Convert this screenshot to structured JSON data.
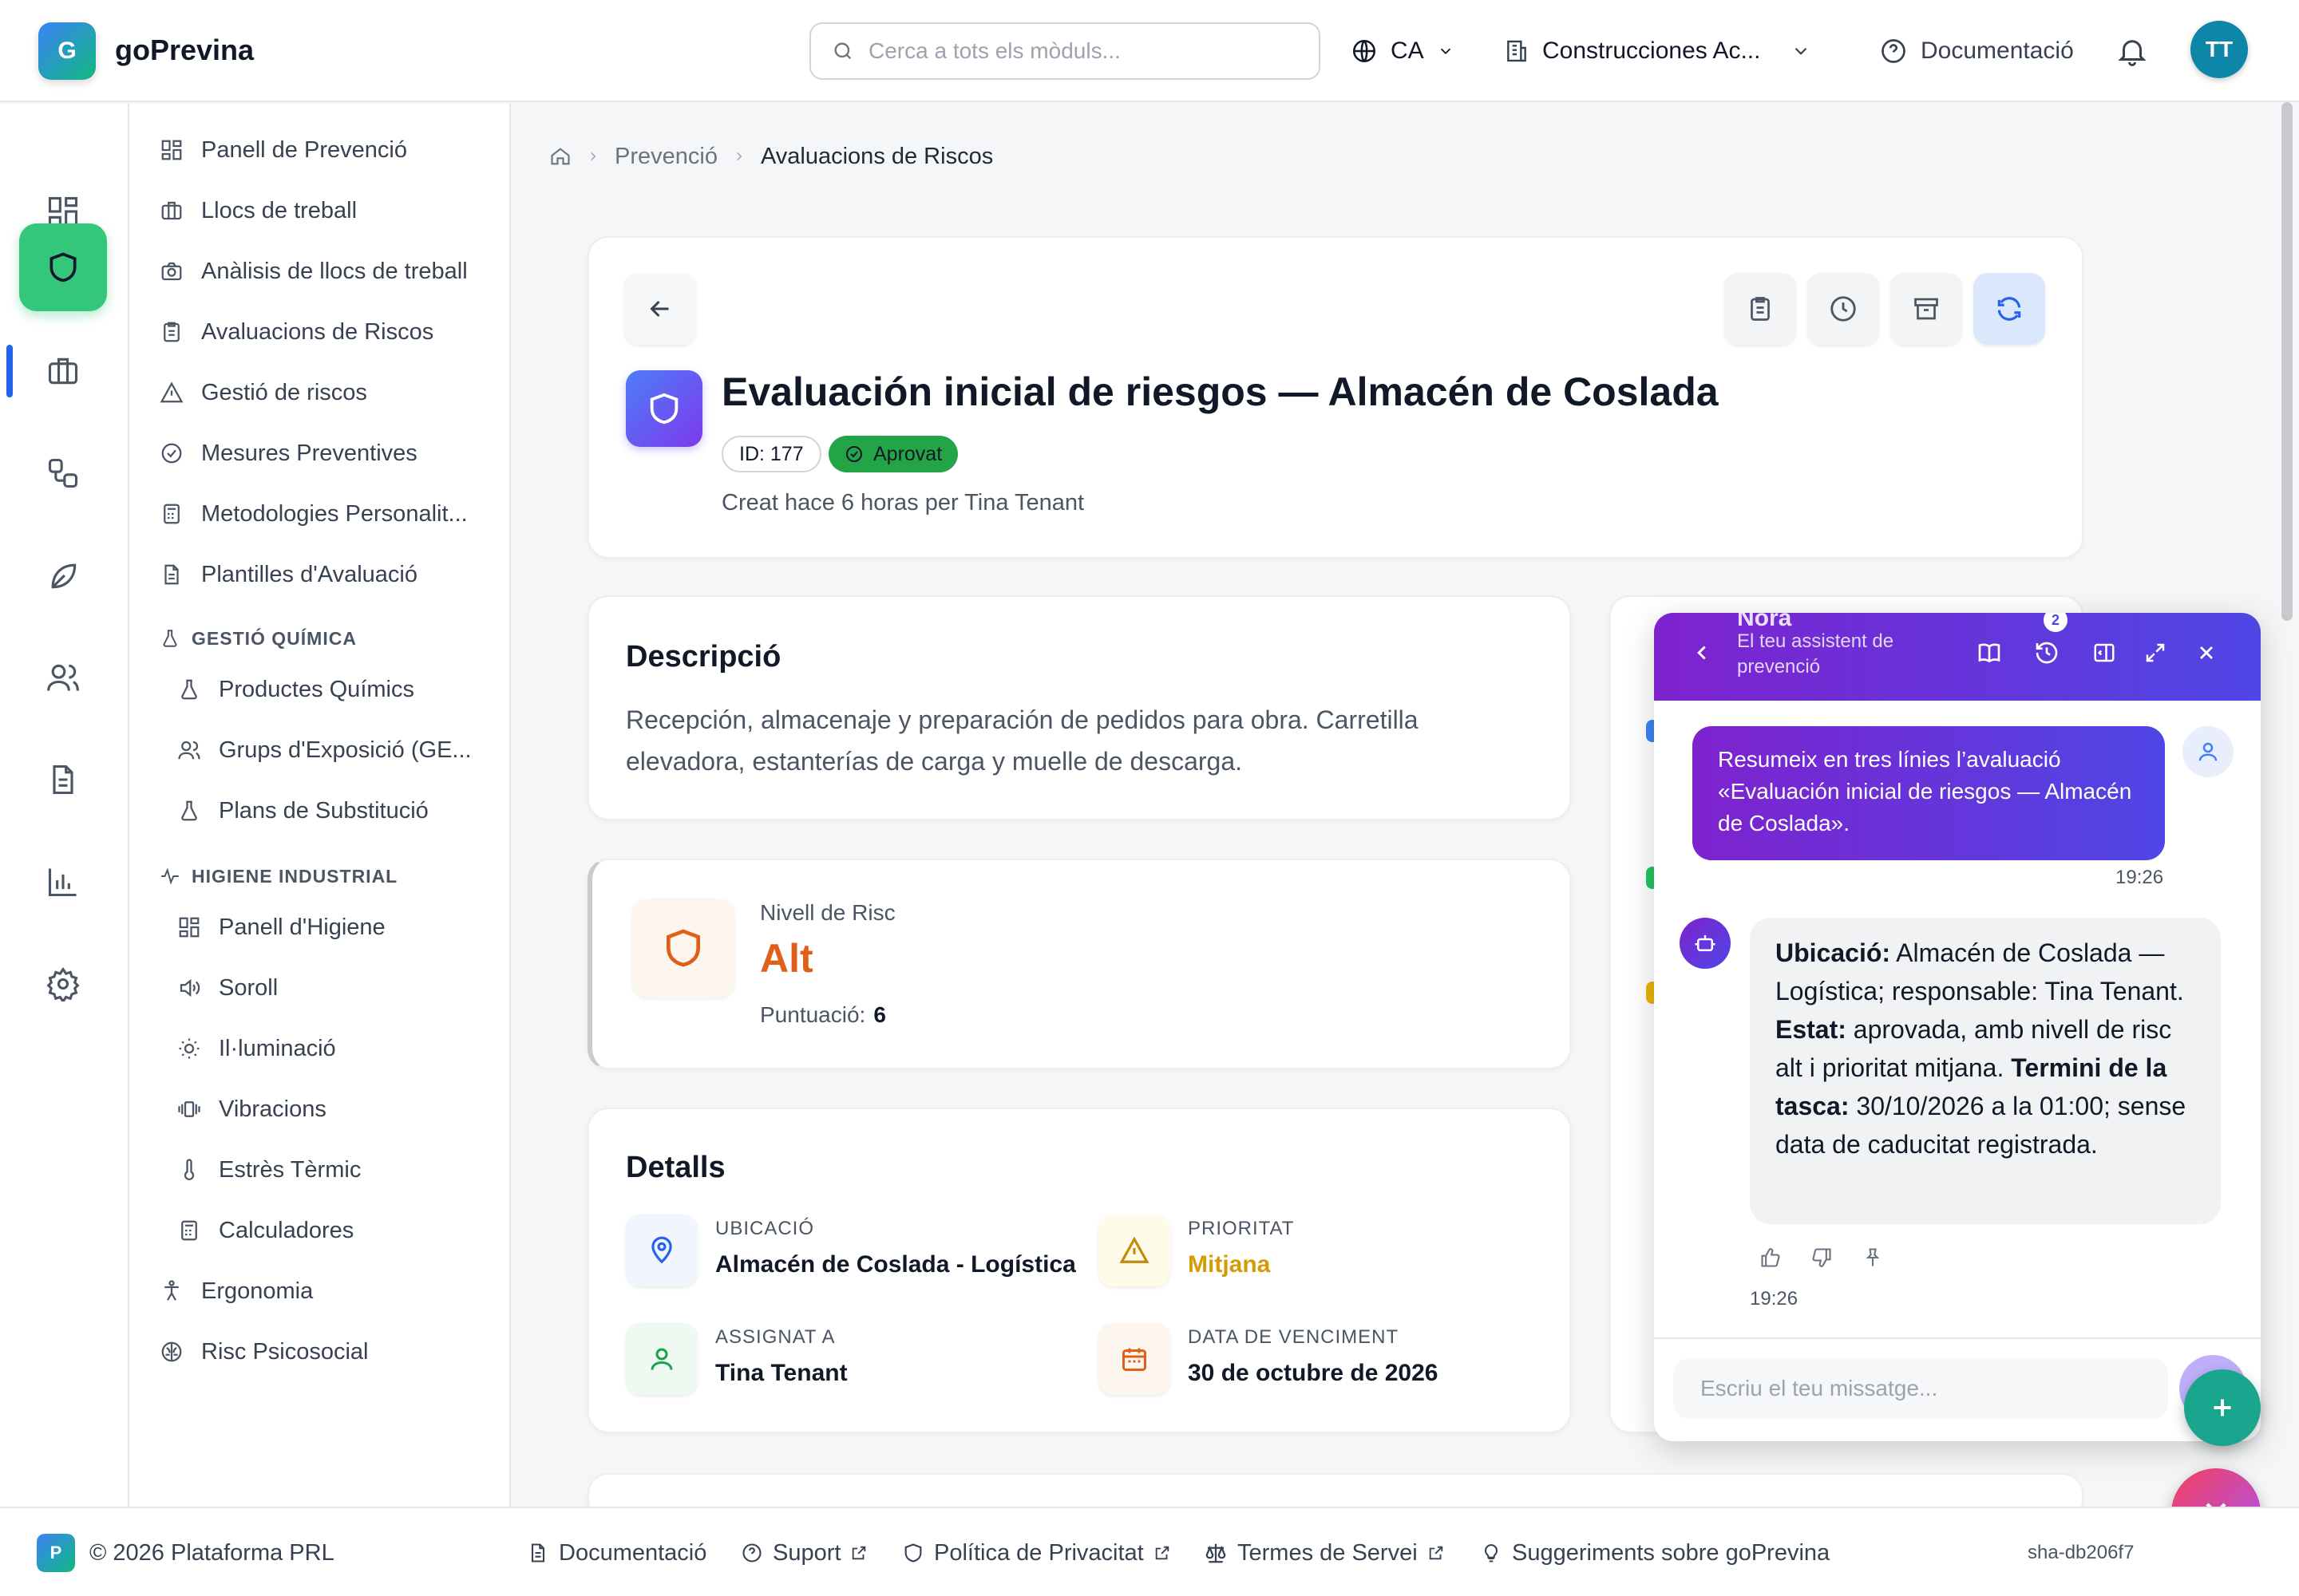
{
  "app": {
    "logo_letter": "G",
    "name": "goPrevina"
  },
  "header": {
    "search_placeholder": "Cerca a tots els mòduls...",
    "language": "CA",
    "company": "Construcciones Ac...",
    "docs": "Documentació",
    "avatar_initials": "TT"
  },
  "sidebar": {
    "items": [
      {
        "label": "Panell de Prevenció",
        "icon": "grid-icon"
      },
      {
        "label": "Llocs de treball",
        "icon": "briefcase-icon"
      },
      {
        "label": "Anàlisis de llocs de treball",
        "icon": "camera-icon"
      },
      {
        "label": "Avaluacions de Riscos",
        "icon": "clipboard-icon"
      },
      {
        "label": "Gestió de riscos",
        "icon": "warning-icon"
      },
      {
        "label": "Mesures Preventives",
        "icon": "check-circle-icon"
      },
      {
        "label": "Metodologies Personalit...",
        "icon": "calculator-icon"
      },
      {
        "label": "Plantilles d'Avaluació",
        "icon": "document-icon"
      }
    ],
    "chem_section": "GESTIÓ QUÍMICA",
    "chem_items": [
      {
        "label": "Productes Químics",
        "icon": "flask-icon"
      },
      {
        "label": "Grups d'Exposició (GE...",
        "icon": "users-icon"
      },
      {
        "label": "Plans de Substitució",
        "icon": "flask-icon"
      }
    ],
    "hyg_section": "HIGIENE INDUSTRIAL",
    "hyg_items": [
      {
        "label": "Panell d'Higiene",
        "icon": "grid-icon"
      },
      {
        "label": "Soroll",
        "icon": "speaker-icon"
      },
      {
        "label": "Il·luminació",
        "icon": "sun-icon"
      },
      {
        "label": "Vibracions",
        "icon": "vibration-icon"
      },
      {
        "label": "Estrès Tèrmic",
        "icon": "thermometer-icon"
      },
      {
        "label": "Calculadores",
        "icon": "calculator-icon"
      }
    ],
    "bottom_items": [
      {
        "label": "Ergonomia",
        "icon": "person-icon"
      },
      {
        "label": "Risc Psicosocial",
        "icon": "brain-icon"
      }
    ]
  },
  "breadcrumb": {
    "parent": "Prevenció",
    "current": "Avaluacions de Riscos"
  },
  "assessment": {
    "title": "Evaluación inicial de riesgos — Almacén de Coslada",
    "id": "ID: 177",
    "status": "Aprovat",
    "created": "Creat hace 6 horas per Tina Tenant"
  },
  "description": {
    "heading": "Descripció",
    "text": "Recepción, almacenaje y preparación de pedidos para obra. Carretilla elevadora, estanterías de carga y muelle de descarga."
  },
  "risk": {
    "label": "Nivell de Risc",
    "level": "Alt",
    "score_label": "Puntuació:",
    "score": "6"
  },
  "details": {
    "heading": "Detalls",
    "location_label": "UBICACIÓ",
    "location": "Almacén de Coslada - Logística",
    "priority_label": "PRIORITAT",
    "priority": "Mitjana",
    "assigned_label": "ASSIGNAT A",
    "assigned": "Tina Tenant",
    "due_label": "DATA DE VENCIMENT",
    "due": "30 de octubre de 2026"
  },
  "chat": {
    "name": "Nora",
    "subtitle": "El teu assistent de prevenció",
    "history_badge": "2",
    "user_message": "Resumeix en tres línies l’avaluació «Evaluación inicial de riesgos — Almacén de Coslada».",
    "user_time": "19:26",
    "bot_l1": "Ubicació:",
    "bot_t1": " Almacén de Coslada — Logística; responsable: Tina Tenant. ",
    "bot_l2": "Estat:",
    "bot_t2": " aprovada, amb nivell de risc alt i prioritat mitjana. ",
    "bot_l3": "Termini de la tasca:",
    "bot_t3": " 30/10/2026 a la 01:00; sense data de caducitat registrada.",
    "bot_time": "19:26",
    "input_placeholder": "Escriu el teu missatge..."
  },
  "footer": {
    "copyright": "© 2026 Plataforma PRL",
    "logo_letter": "P",
    "docs": "Documentació",
    "support": "Suport",
    "privacy": "Política de Privacitat",
    "terms": "Termes de Servei",
    "suggestions": "Suggeriments sobre goPrevina",
    "version": "sha-db206f7"
  },
  "colors": {
    "accent_green": "#34c77b",
    "status_green": "#22a447",
    "risk_orange": "#e0601a",
    "priority_yellow": "#d49b06",
    "chat_gradient_start": "#7e22ce",
    "chat_gradient_end": "#4f46e5"
  }
}
